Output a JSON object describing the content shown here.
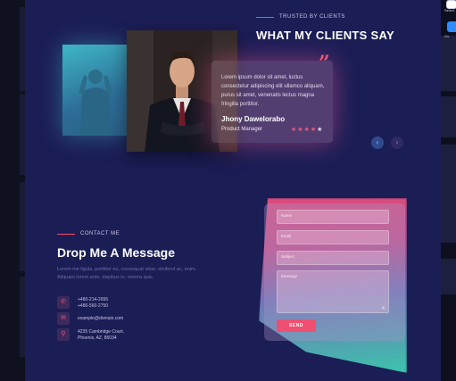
{
  "colors": {
    "page_bg": "#1b1d55",
    "accent": "#ef4e6b",
    "prev_button": "#2f4a8e"
  },
  "side_panel": {
    "top_label": "Select",
    "blue_label": "Go"
  },
  "testimonials": {
    "eyebrow": "TRUSTED BY CLIENTS",
    "heading": "WHAT MY CLIENTS SAY",
    "quote_icon": "quote-icon",
    "text": "Lorem ipsum dolor sit amet, luctus consectetur adipiscing elit ullamco aliquam, purus sit amet, venenatis lectus magna fringilla porttitor.",
    "name": "Jhony Dawelorabo",
    "role": "Product Manager",
    "rating": 4,
    "rating_max": 5,
    "prev_label": "‹",
    "next_label": "›"
  },
  "contact": {
    "eyebrow": "CONTACT ME",
    "heading": "Drop Me A Message",
    "description": "Lorem me ligula, porttitor eu, consequat vitae, eleifend ac, enim. Aliquam lorem ante, dapibus in, viverra quis.",
    "phone_lines": [
      "+480-214-2655",
      "+480-560-2750"
    ],
    "email": "example@domain.com",
    "address_lines": [
      "4235 Cambridge Court,",
      "Phoenix, AZ, 85034"
    ],
    "icons": {
      "phone": "phone-icon",
      "email": "envelope-icon",
      "address": "location-pin-icon"
    }
  },
  "form": {
    "name_placeholder": "Name",
    "email_placeholder": "Email",
    "subject_placeholder": "Subject",
    "message_placeholder": "Message",
    "send_label": "SEND"
  }
}
